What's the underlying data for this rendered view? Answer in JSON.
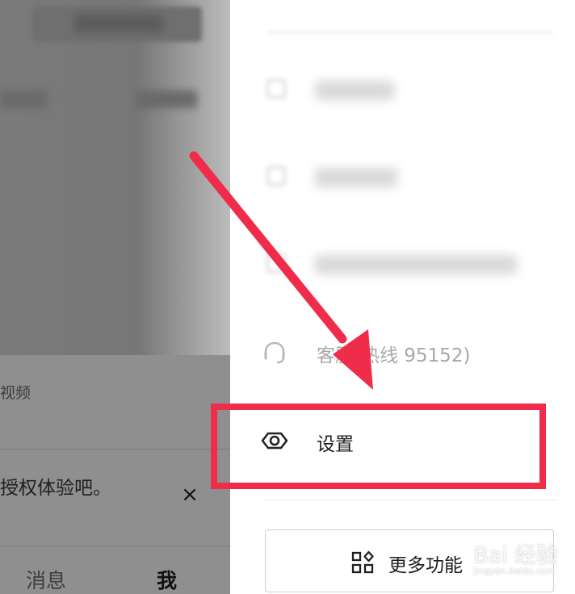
{
  "left_panel": {
    "video_label": "视频",
    "toast_text": "授权体验吧。",
    "close_symbol": "×",
    "tabs": [
      {
        "label": "消息"
      },
      {
        "label": "我"
      }
    ]
  },
  "menu": {
    "customer_service_label": "客服(热线 95152)",
    "settings_label": "设置",
    "more_functions_label": "更多功能"
  },
  "annotation": {
    "color": "#ef2d4b"
  },
  "watermark": {
    "main": "Bai 经验",
    "sub": "jingyan.baidu.com"
  },
  "icons": {
    "settings": "settings-hex-icon",
    "customer_service": "headset-icon",
    "more_functions": "grid-icon",
    "close": "close-icon"
  }
}
